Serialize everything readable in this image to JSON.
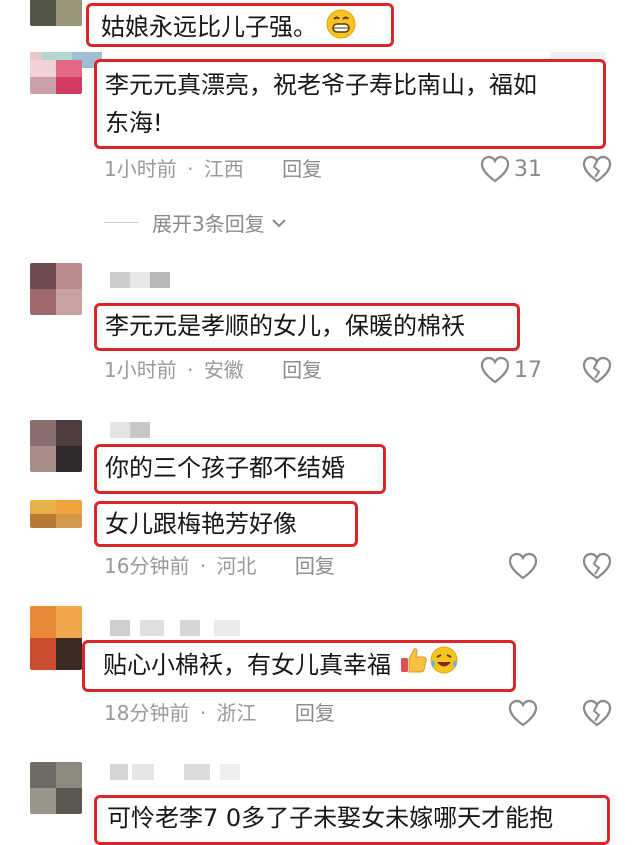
{
  "comments": [
    {
      "text": "姑娘永远比儿子强。"
    },
    {
      "text": "李元元真漂亮，祝老爷子寿比南山，福如东海!",
      "line1": "李元元真漂亮，祝老爷子寿比南山，福如",
      "line2": "东海!",
      "time": "1小时前",
      "location": "江西",
      "reply": "回复",
      "likes": "31"
    },
    {
      "text": "李元元是孝顺的女儿，保暖的棉袄",
      "time": "1小时前",
      "location": "安徽",
      "reply": "回复",
      "likes": "17"
    },
    {
      "text": "你的三个孩子都不结婚"
    },
    {
      "text": "女儿跟梅艳芳好像",
      "time": "16分钟前",
      "location": "河北",
      "reply": "回复",
      "likes": ""
    },
    {
      "text": "贴心小棉袄，有女儿真幸福",
      "time": "18分钟前",
      "location": "浙江",
      "reply": "回复",
      "likes": ""
    },
    {
      "text": "可怜老李7 0多了子未娶女未嫁哪天才能抱"
    }
  ],
  "expand_replies": "展开3条回复",
  "separator": "·",
  "icons": {
    "like": "heart-outline-icon",
    "dislike": "broken-heart-icon",
    "expand": "chevron-down-icon",
    "emoji_grin": "grinning-face-emoji",
    "emoji_thumb": "thumbs-up-emoji",
    "emoji_laugh": "laughing-tears-emoji"
  },
  "colors": {
    "highlight_border": "#d9262b",
    "meta_text": "#9a9a9a",
    "text": "#161616"
  }
}
